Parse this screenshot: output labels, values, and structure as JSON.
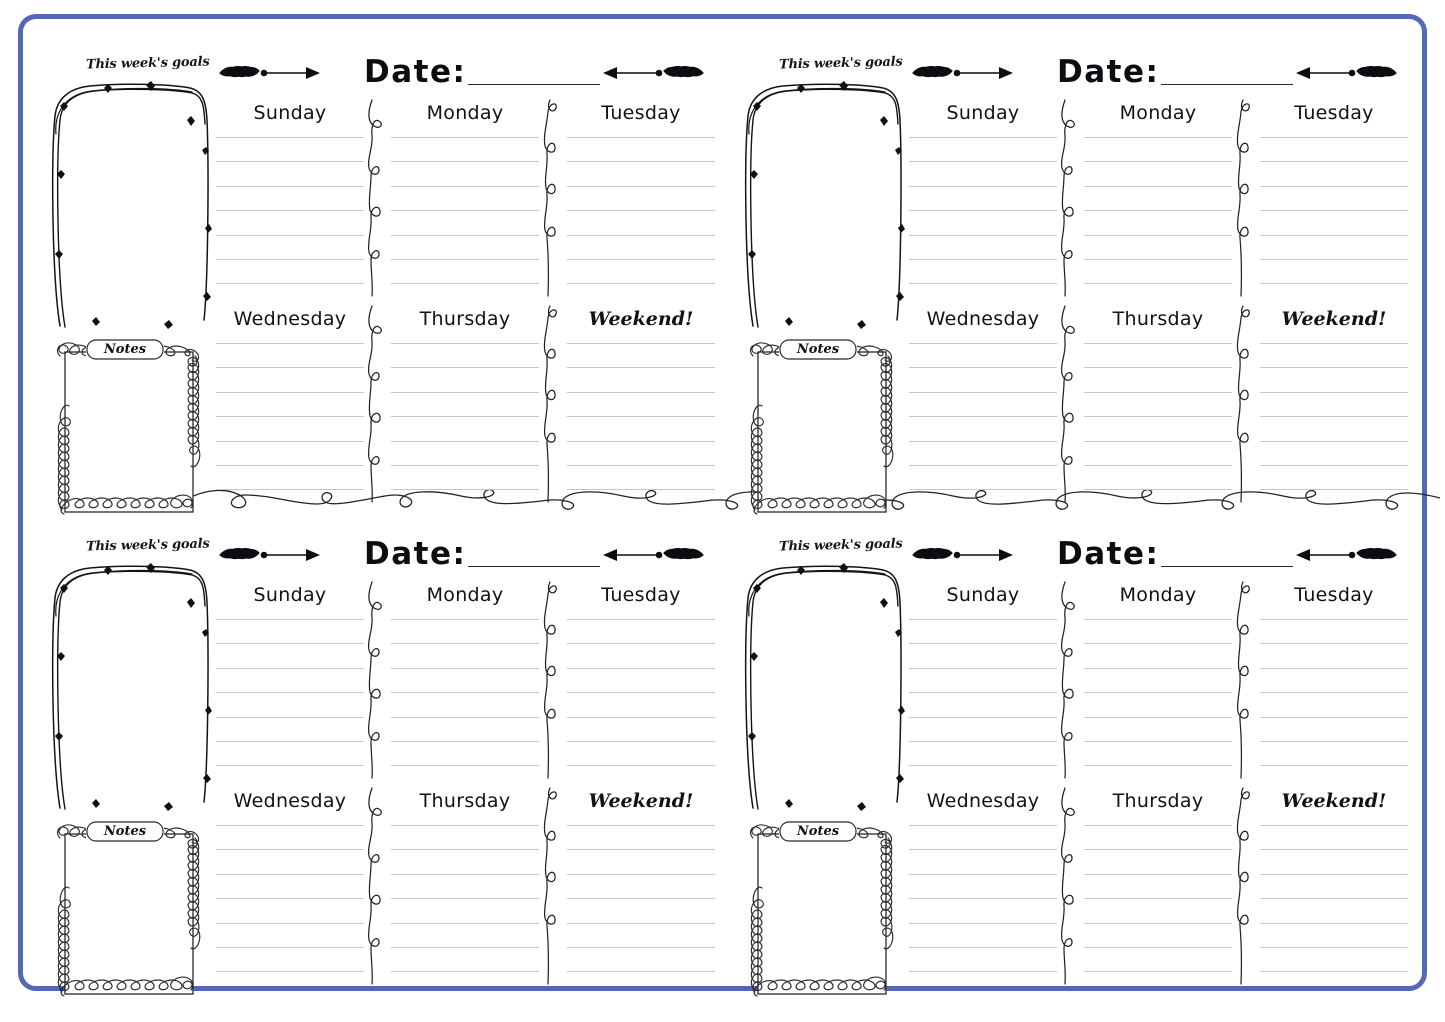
{
  "document": {
    "type": "weekly-planner-printable",
    "border_color": "#5568b8",
    "background_color": "#ffffff",
    "ink_color": "#15151a",
    "rule_color": "#c7c7cb",
    "quadrant_count": 4
  },
  "labels": {
    "goals_title": "This week's goals",
    "notes_title": "Notes",
    "date_label": "Date:",
    "date_value": "",
    "date_placeholder": ""
  },
  "icons": {
    "arrow_right": "feathered-arrow-right-icon",
    "arrow_left": "feathered-arrow-left-icon",
    "divider_vertical": "squiggle-divider-icon",
    "divider_horizontal": "squiggle-divider-horizontal-icon",
    "goals_frame": "sketch-frame-icon",
    "notes_frame": "curly-loop-frame-icon"
  },
  "days": [
    {
      "label": "Sunday",
      "lines": 7,
      "style": "plain"
    },
    {
      "label": "Monday",
      "lines": 7,
      "style": "plain"
    },
    {
      "label": "Tuesday",
      "lines": 7,
      "style": "plain"
    },
    {
      "label": "Wednesday",
      "lines": 7,
      "style": "plain"
    },
    {
      "label": "Thursday",
      "lines": 7,
      "style": "plain"
    },
    {
      "label": "Weekend!",
      "lines": 7,
      "style": "script"
    }
  ],
  "weeks": [
    {
      "id": "week-1",
      "position": "top-left",
      "date_value": ""
    },
    {
      "id": "week-2",
      "position": "top-right",
      "date_value": ""
    },
    {
      "id": "week-3",
      "position": "bottom-left",
      "date_value": ""
    },
    {
      "id": "week-4",
      "position": "bottom-right",
      "date_value": ""
    }
  ]
}
